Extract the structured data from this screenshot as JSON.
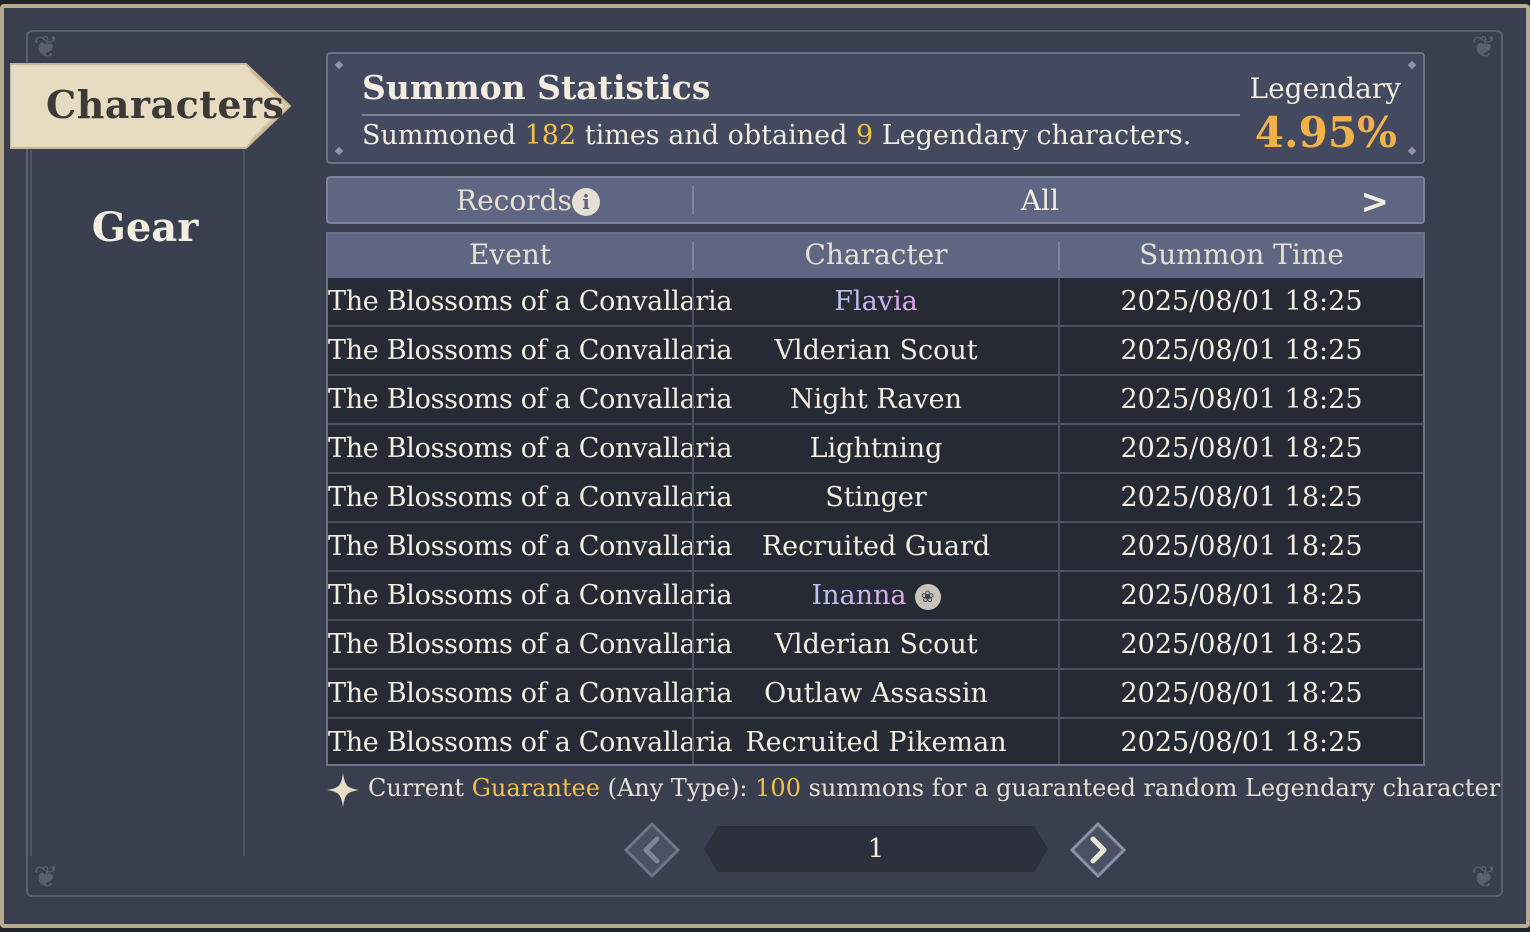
{
  "sidebar": {
    "tabs": [
      {
        "label": "Characters",
        "active": true
      },
      {
        "label": "Gear",
        "active": false
      }
    ]
  },
  "stats": {
    "title": "Summon Statistics",
    "summary_prefix": "Summoned",
    "summon_count": "182",
    "summary_mid": "times and obtained",
    "legendary_count": "9",
    "summary_suffix": "Legendary characters.",
    "rate_label": "Legendary",
    "rate_value": "4.95%"
  },
  "records": {
    "label": "Records",
    "filter_value": "All"
  },
  "table": {
    "headers": [
      "Event",
      "Character",
      "Summon Time"
    ],
    "rows": [
      {
        "event": "The Blossoms of a Convallaria",
        "character": "Flavia",
        "time": "2025/08/01 18:25",
        "legendary": true
      },
      {
        "event": "The Blossoms of a Convallaria",
        "character": "Vlderian Scout",
        "time": "2025/08/01 18:25",
        "legendary": false
      },
      {
        "event": "The Blossoms of a Convallaria",
        "character": "Night Raven",
        "time": "2025/08/01 18:25",
        "legendary": false
      },
      {
        "event": "The Blossoms of a Convallaria",
        "character": "Lightning",
        "time": "2025/08/01 18:25",
        "legendary": false
      },
      {
        "event": "The Blossoms of a Convallaria",
        "character": "Stinger",
        "time": "2025/08/01 18:25",
        "legendary": false
      },
      {
        "event": "The Blossoms of a Convallaria",
        "character": "Recruited Guard",
        "time": "2025/08/01 18:25",
        "legendary": false
      },
      {
        "event": "The Blossoms of a Convallaria",
        "character": "Inanna",
        "time": "2025/08/01 18:25",
        "legendary": true,
        "badge": true
      },
      {
        "event": "The Blossoms of a Convallaria",
        "character": "Vlderian Scout",
        "time": "2025/08/01 18:25",
        "legendary": false
      },
      {
        "event": "The Blossoms of a Convallaria",
        "character": "Outlaw Assassin",
        "time": "2025/08/01 18:25",
        "legendary": false
      },
      {
        "event": "The Blossoms of a Convallaria",
        "character": "Recruited Pikeman",
        "time": "2025/08/01 18:25",
        "legendary": false
      }
    ]
  },
  "guarantee": {
    "prefix": "Current",
    "keyword": "Guarantee",
    "type": "(Any Type):",
    "count": "100",
    "suffix": "summons for a guaranteed random Legendary character"
  },
  "pagination": {
    "page": "1"
  },
  "colors": {
    "accent_gold": "#f2bf4a",
    "panel": "#3a3f50",
    "header": "#5f6682",
    "active_tab": "#e7dcc1"
  }
}
